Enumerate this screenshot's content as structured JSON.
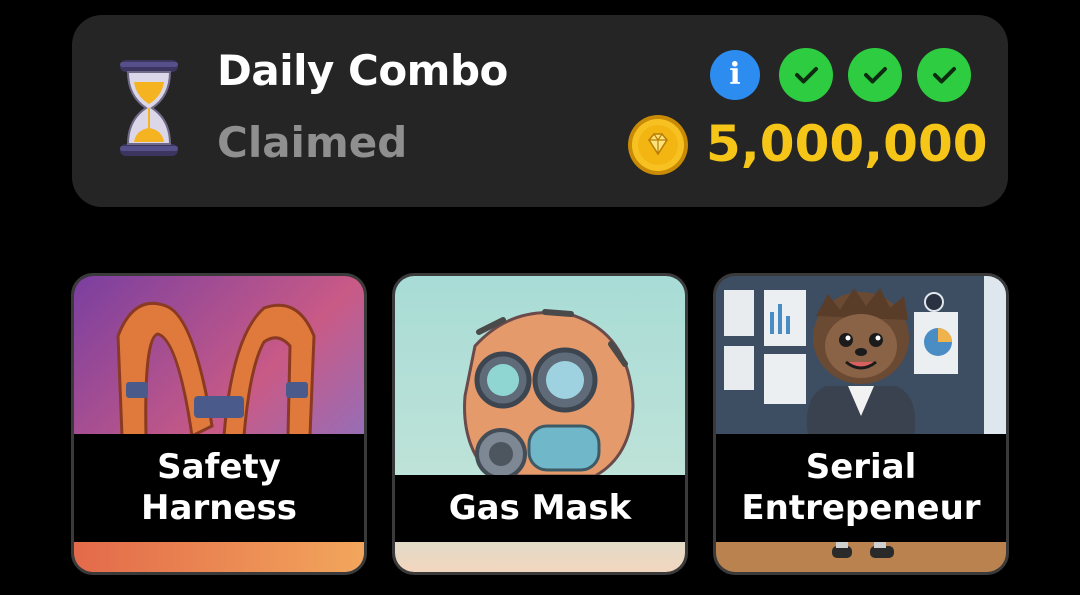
{
  "combo": {
    "title": "Daily Combo",
    "status": "Claimed",
    "info_icon": "info-icon",
    "info_glyph": "i",
    "checks": [
      "check-icon",
      "check-icon",
      "check-icon"
    ],
    "coin_icon": "coin-icon",
    "reward": "5,000,000"
  },
  "cards": [
    {
      "line1": "Safety",
      "line2": "Harness"
    },
    {
      "line1": "Gas Mask",
      "line2": ""
    },
    {
      "line1": "Serial",
      "line2": "Entrepeneur"
    }
  ],
  "colors": {
    "card_bg": "#252525",
    "title": "#ffffff",
    "status": "#8f8f8f",
    "info_blue": "#2d8cf0",
    "check_green": "#2ecc40",
    "reward_gold": "#f5c518"
  }
}
